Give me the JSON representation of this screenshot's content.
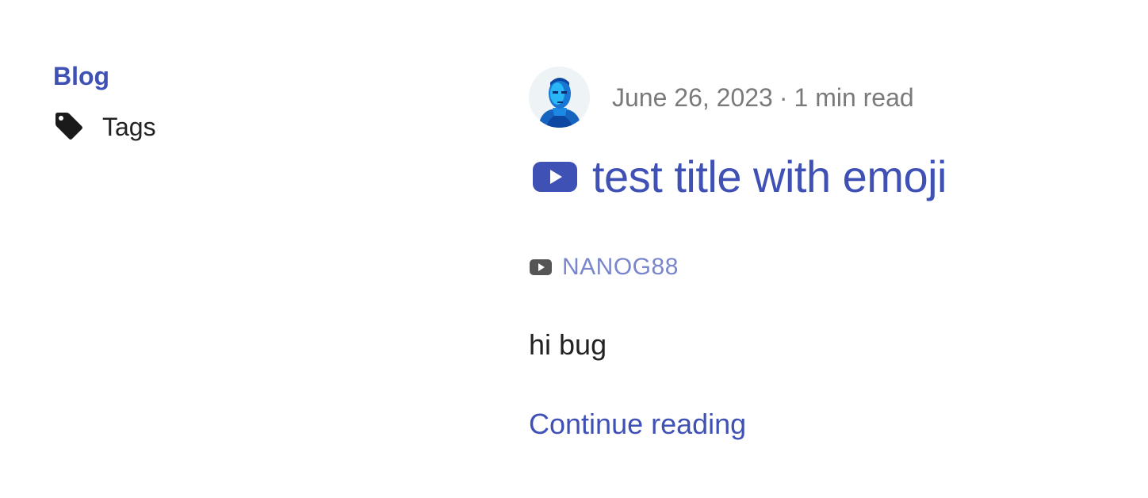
{
  "sidebar": {
    "blog_label": "Blog",
    "tags_label": "Tags",
    "tags_icon": "tag-icon"
  },
  "post": {
    "author_avatar": "avatar",
    "date": "June 26, 2023",
    "separator": "·",
    "read_time": "1 min read",
    "title_icon": "youtube-icon",
    "title": "test title with emoji",
    "tag_icon": "youtube-icon",
    "tag": "NANOG88",
    "excerpt": "hi bug",
    "continue_label": "Continue reading"
  },
  "colors": {
    "accent": "#3f51b5",
    "accent_light": "#7986cb",
    "meta_gray": "#7a7a7a",
    "text": "#222222"
  }
}
